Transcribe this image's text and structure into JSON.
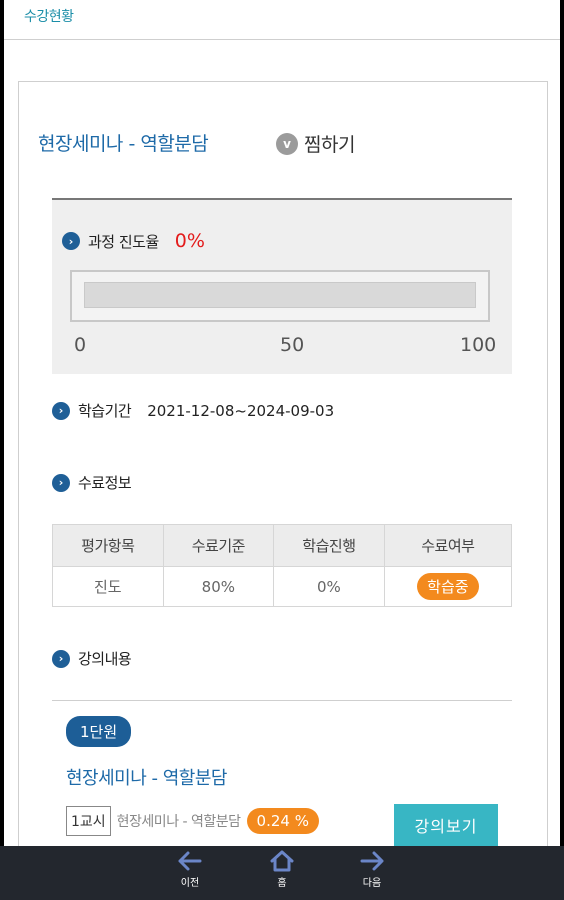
{
  "header": {
    "title": "수강현황"
  },
  "course": {
    "title": "현장세미나 - 역할분담",
    "wish_icon": "v",
    "wish_label": "찜하기"
  },
  "progress": {
    "label": "과정 진도율",
    "percent_text": "0%",
    "value": 0,
    "ticks": [
      "0",
      "50",
      "100"
    ]
  },
  "period": {
    "label": "학습기간",
    "value": "2021-12-08~2024-09-03"
  },
  "completion": {
    "label": "수료정보",
    "headers": [
      "평가항목",
      "수료기준",
      "학습진행",
      "수료여부"
    ],
    "row": {
      "item": "진도",
      "criterion": "80%",
      "progress": "0%",
      "status": "학습중"
    }
  },
  "content": {
    "label": "강의내용",
    "unit": "1단원",
    "unit_title": "현장세미나 - 역할분담",
    "lesson": {
      "period": "1교시",
      "name": "현장세미나 - 역할분담",
      "percent": "0.24 %",
      "button": "강의보기"
    }
  },
  "nav": {
    "prev": "이전",
    "home": "홈",
    "next": "다음"
  },
  "colors": {
    "accent": "#1e6aa8",
    "alert": "#e31b1b",
    "badge": "#f38a1e",
    "button": "#38b6c4"
  }
}
